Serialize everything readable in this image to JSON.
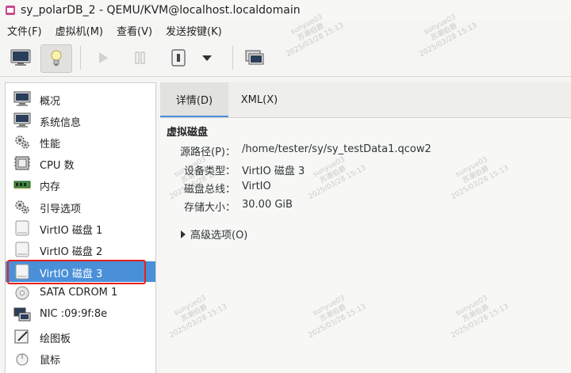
{
  "window": {
    "title": "sy_polarDB_2 - QEMU/KVM@localhost.localdomain"
  },
  "menu": [
    {
      "label": "文件(F)"
    },
    {
      "label": "虚拟机(M)"
    },
    {
      "label": "查看(V)"
    },
    {
      "label": "发送按键(K)"
    }
  ],
  "toolbar": {
    "buttons": [
      {
        "name": "console",
        "icon": "monitor-icon"
      },
      {
        "name": "details",
        "icon": "lightbulb-icon",
        "active": true
      },
      {
        "name": "run",
        "icon": "play-icon"
      },
      {
        "name": "pause",
        "icon": "pause-icon"
      },
      {
        "name": "shutdown",
        "icon": "power-icon"
      },
      {
        "name": "shutdown-menu",
        "icon": "chevron-down-icon"
      },
      {
        "name": "snapshots",
        "icon": "snapshot-icon"
      }
    ]
  },
  "sidebar": {
    "items": [
      {
        "label": "概况",
        "icon": "monitor-icon"
      },
      {
        "label": "系统信息",
        "icon": "monitor-icon"
      },
      {
        "label": "性能",
        "icon": "gears-icon"
      },
      {
        "label": "CPU 数",
        "icon": "cpu-icon"
      },
      {
        "label": "内存",
        "icon": "memory-icon"
      },
      {
        "label": "引导选项",
        "icon": "gears-icon"
      },
      {
        "label": "VirtIO 磁盘 1",
        "icon": "disk-icon"
      },
      {
        "label": "VirtIO 磁盘 2",
        "icon": "disk-icon"
      },
      {
        "label": "VirtIO 磁盘 3",
        "icon": "disk-icon",
        "selected": true
      },
      {
        "label": "SATA CDROM 1",
        "icon": "cdrom-icon"
      },
      {
        "label": "NIC :09:9f:8e",
        "icon": "network-icon"
      },
      {
        "label": "绘图板",
        "icon": "tablet-icon"
      },
      {
        "label": "鼠标",
        "icon": "mouse-icon"
      }
    ]
  },
  "tabs": [
    {
      "label": "详情(D)",
      "active": true
    },
    {
      "label": "XML(X)"
    }
  ],
  "details": {
    "section_title": "虚拟磁盘",
    "rows": [
      {
        "label": "源路径(P)：",
        "value": "/home/tester/sy/sy_testData1.qcow2"
      },
      {
        "label": "设备类型：",
        "value": "VirtIO 磁盘 3"
      },
      {
        "label": "磁盘总线：",
        "value": "VirtIO"
      },
      {
        "label": "存储大小：",
        "value": "30.00 GiB"
      }
    ],
    "advanced_label": "高级选项(O)"
  },
  "watermark": {
    "line1": "sunyue03",
    "line2": "苏潮伯爵",
    "line3": "2025/03/28 15:13"
  },
  "colors": {
    "selection": "#4a90d9",
    "highlight_box": "#e2231a"
  }
}
